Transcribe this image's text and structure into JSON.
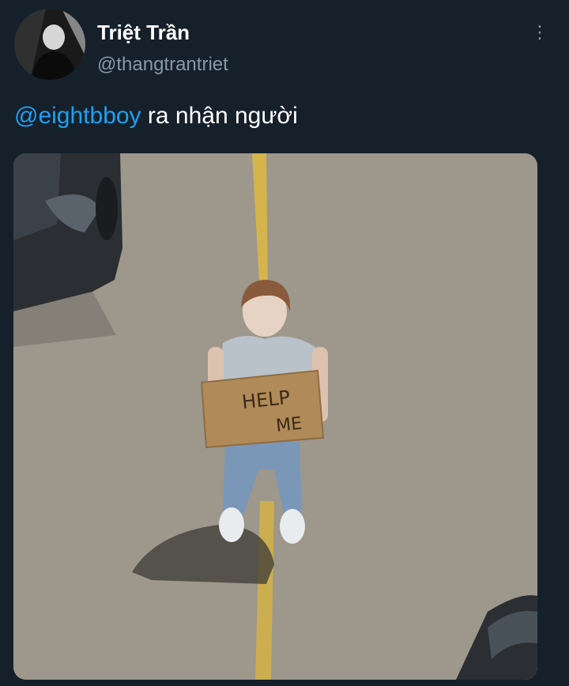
{
  "author": {
    "display_name": "Triệt Trần",
    "handle": "@thangtrantriet",
    "avatar_icon": "user-avatar-photo"
  },
  "menu": {
    "icon": "more-vertical-icon"
  },
  "tweet": {
    "mention": "@eightbboy",
    "text": " ra nhận người"
  },
  "media": {
    "sign_line1": "HELP",
    "sign_line2": "ME",
    "colors": {
      "road": "#a09a8e",
      "lane_line": "#d8b64a",
      "car": "#2c3034",
      "hoodie": "#b9c2c8",
      "jeans": "#7b97b8",
      "sign": "#b08a58"
    }
  },
  "theme": {
    "background": "#15202b",
    "text": "#ffffff",
    "secondary": "#8899a6",
    "link": "#1da1f2"
  }
}
